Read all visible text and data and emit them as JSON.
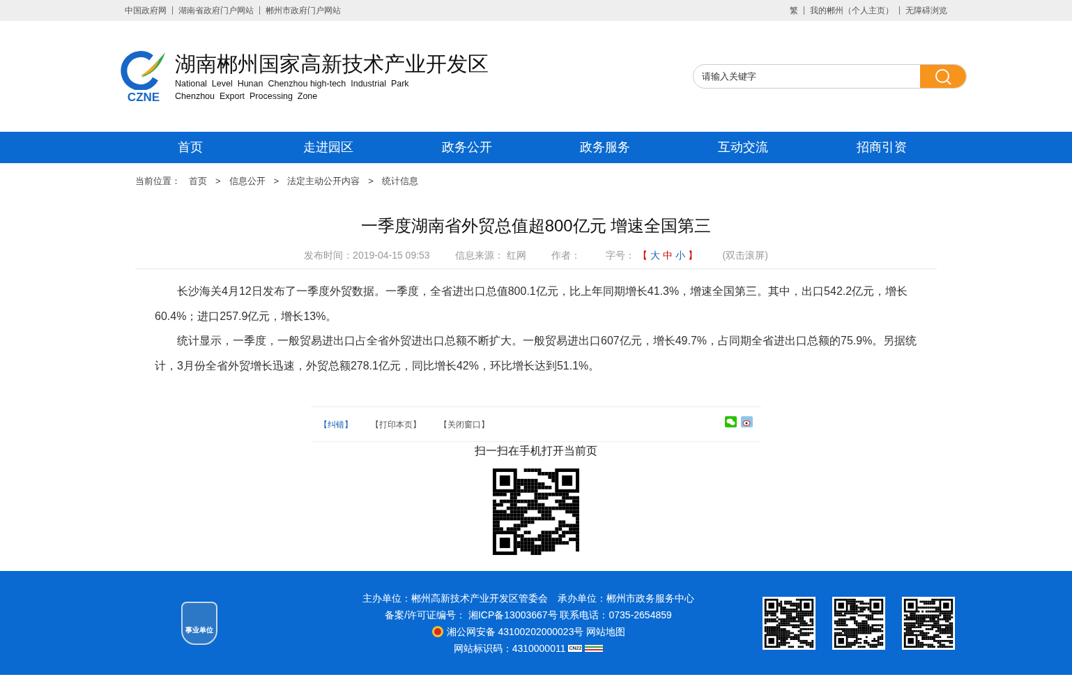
{
  "top_bar": {
    "left_links": [
      "中国政府网",
      "湖南省政府门户网站",
      "郴州市政府门户网站"
    ],
    "right_links": [
      "繁",
      "我的郴州（个人主页）",
      "无障碍浏览"
    ]
  },
  "header": {
    "logo_text": "CZNE",
    "title": "湖南郴州国家高新技术产业开发区",
    "subtitle_lines": [
      "National  Level  Hunan  Chenzhou high-tech  Industrial  Park",
      "Chenzhou  Export  Processing  Zone"
    ],
    "search": {
      "placeholder": "请输入关键字"
    }
  },
  "nav": [
    {
      "label": "首页",
      "selected": false
    },
    {
      "label": "走进园区",
      "selected": false
    },
    {
      "label": "政务公开",
      "selected": false
    },
    {
      "label": "政务服务",
      "selected": false
    },
    {
      "label": "互动交流",
      "selected": false
    },
    {
      "label": "招商引资",
      "selected": false
    }
  ],
  "breadcrumb": {
    "label": "当前位置：",
    "items": [
      "首页",
      "信息公开",
      "法定主动公开内容",
      "统计信息"
    ],
    "separator": ">"
  },
  "article": {
    "title": "一季度湖南省外贸总值超800亿元 增速全国第三",
    "meta": {
      "published": "发布时间：2019-04-15 09:53",
      "source": "信息来源： 红网",
      "author": "作者：",
      "font_label": "字号：",
      "font_open": "【",
      "font_sizes": [
        {
          "label": "大",
          "color": "#1a5fb4"
        },
        {
          "label": "中",
          "color": "#d40000"
        },
        {
          "label": "小",
          "color": "#1a5fb4"
        }
      ],
      "font_close": "】",
      "scroll": "(双击滚屏)"
    },
    "paragraphs": [
      "长沙海关4月12日发布了一季度外贸数据。一季度，全省进出口总值800.1亿元，比上年同期增长41.3%，增速全国第三。其中，出口542.2亿元，增长60.4%；进口257.9亿元，增长13%。",
      "统计显示，一季度，一般贸易进出口占全省外贸进出口总额不断扩大。一般贸易进出口607亿元，增长49.7%，占同期全省进出口总额的75.9%。另据统计，3月份全省外贸增长迅速，外贸总额278.1亿元，同比增长42%，环比增长达到51.1%。"
    ]
  },
  "actions": [
    {
      "label": "【纠错】",
      "kind": "link"
    },
    {
      "label": "【打印本页】",
      "kind": "plain"
    },
    {
      "label": "【关闭窗口】",
      "kind": "plain"
    }
  ],
  "qr_caption": "扫一扫在手机打开当前页",
  "footer": {
    "badge_text": "事业单位",
    "lines": [
      "主办单位：郴州高新技术产业开发区管委会　承办单位：郴州市政务服务中心",
      "备案/许可证编号： 湘ICP备13003667号 联系电话：0735-2654859"
    ],
    "police": "湘公网安备 43100202000023号",
    "sitemap": "网站地图",
    "site_id": "网站标识码：4310000011",
    "cn_badge": "CN22"
  }
}
